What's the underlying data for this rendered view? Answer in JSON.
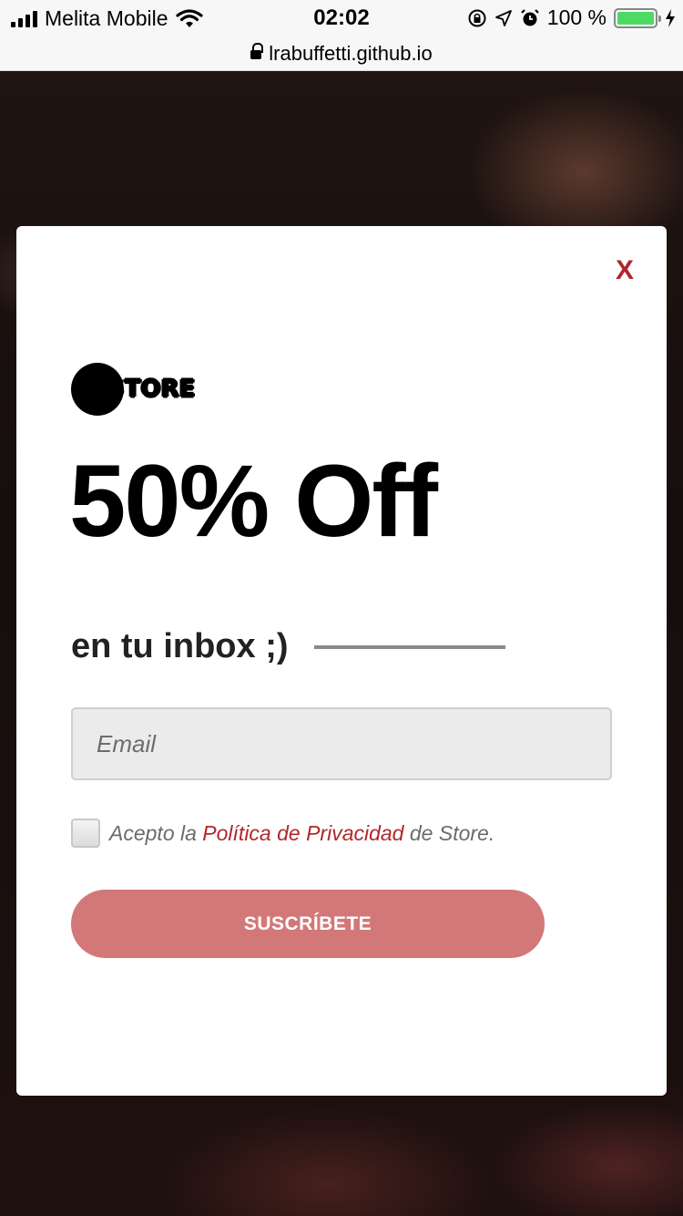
{
  "status_bar": {
    "carrier": "Melita Mobile",
    "time": "02:02",
    "battery_percent": "100 %",
    "icons": [
      "signal-icon",
      "wifi-icon",
      "orientation-lock-icon",
      "location-icon",
      "alarm-icon",
      "battery-icon",
      "charging-icon"
    ]
  },
  "browser": {
    "url": "lrabuffetti.github.io"
  },
  "modal": {
    "close_label": "X",
    "logo_text": "STORE",
    "headline": "50% Off",
    "subline": "en tu inbox ;)",
    "email": {
      "placeholder": "Email",
      "value": ""
    },
    "consent": {
      "prefix": "Acepto la ",
      "link_text": "Política de Privacidad",
      "suffix": " de Store.",
      "checked": false
    },
    "subscribe_label": "SUSCRÍBETE"
  },
  "colors": {
    "accent": "#b0272b",
    "button": "#d37878",
    "battery": "#4cd964"
  }
}
